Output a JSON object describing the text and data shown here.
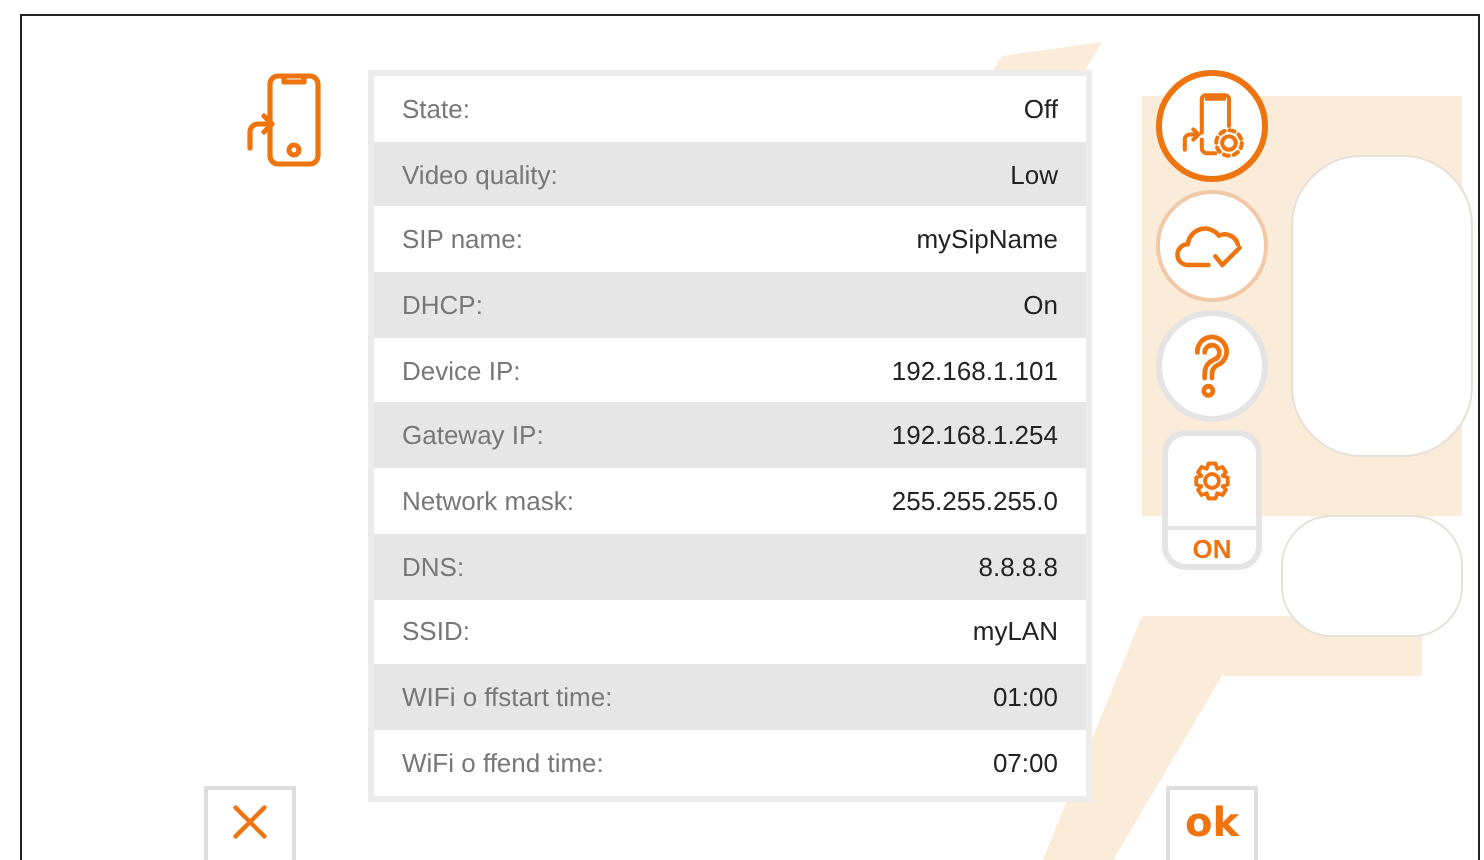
{
  "settings": [
    {
      "label": "State:",
      "value": "Off"
    },
    {
      "label": "Video quality:",
      "value": "Low"
    },
    {
      "label": "SIP name:",
      "value": "mySipName"
    },
    {
      "label": "DHCP:",
      "value": "On"
    },
    {
      "label": "Device IP:",
      "value": "192.168.1.101"
    },
    {
      "label": "Gateway IP:",
      "value": "192.168.1.254"
    },
    {
      "label": "Network mask:",
      "value": "255.255.255.0"
    },
    {
      "label": "DNS:",
      "value": "8.8.8.8"
    },
    {
      "label": "SSID:",
      "value": "myLAN"
    },
    {
      "label": "WIFi o ffstart time:",
      "value": "01:00"
    },
    {
      "label": "WiFi o ffend time:",
      "value": "07:00"
    }
  ],
  "side_buttons": [
    {
      "kind": "phone-settings",
      "selected": true
    },
    {
      "kind": "cloud",
      "selected": false
    },
    {
      "kind": "help",
      "selected": false
    },
    {
      "kind": "gear",
      "selected": false,
      "label": "ON"
    }
  ],
  "actions": [
    {
      "kind": "cancel"
    },
    {
      "kind": "ok",
      "label": "ok"
    }
  ]
}
